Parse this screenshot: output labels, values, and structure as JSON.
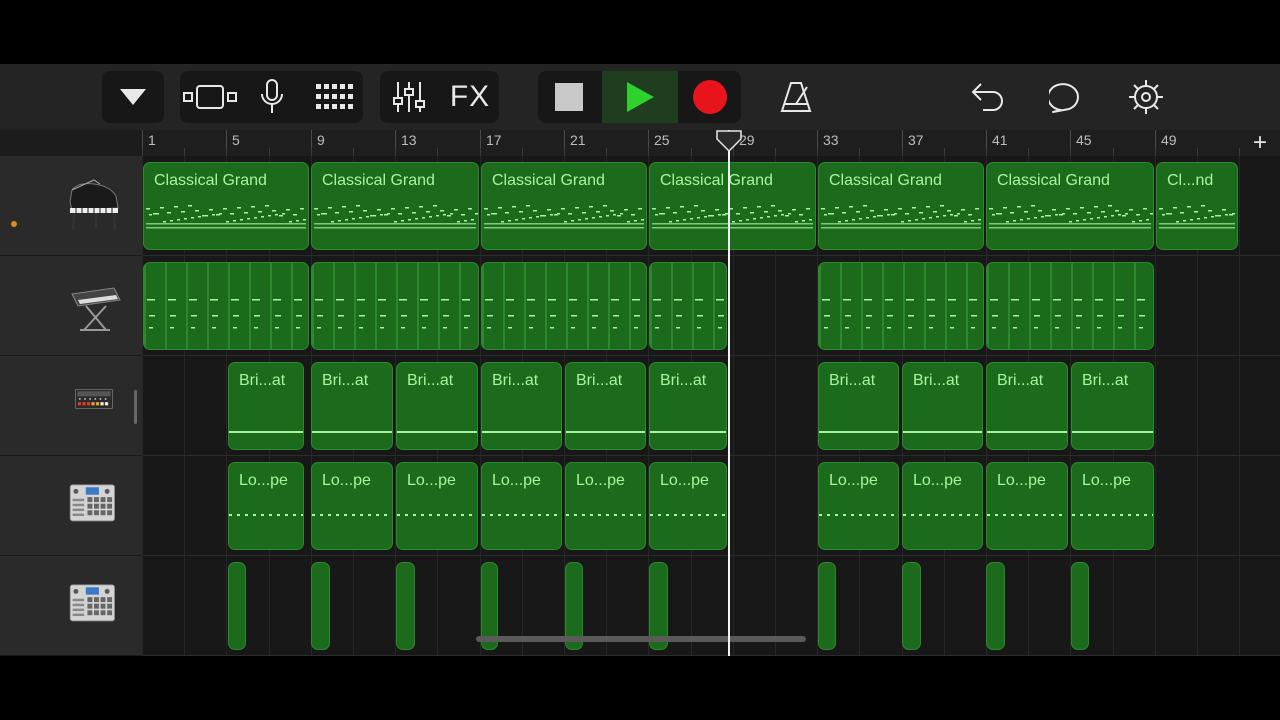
{
  "toolbar": {
    "fx_label": "FX"
  },
  "ruler": {
    "bar_labels": [
      "1",
      "5",
      "9",
      "13",
      "17",
      "21",
      "25",
      "29",
      "33",
      "37",
      "41",
      "45",
      "49"
    ]
  },
  "add_track_label": "+",
  "tracks": [
    {
      "instrument": "grand-piano-icon",
      "selected": true
    },
    {
      "instrument": "keyboard-synth-icon"
    },
    {
      "instrument": "drum-machine-icon"
    },
    {
      "instrument": "beat-sampler-icon"
    },
    {
      "instrument": "beat-sampler-icon"
    }
  ],
  "regions": {
    "track1": [
      "Classical Grand",
      "Classical Grand",
      "Classical Grand",
      "Classical Grand",
      "Classical Grand",
      "Classical Grand",
      "Cl...nd"
    ],
    "track3": [
      "Bri...at",
      "Bri...at",
      "Bri...at",
      "Bri...at",
      "Bri...at",
      "Bri...at",
      "Bri...at",
      "Bri...at",
      "Bri...at",
      "Bri...at"
    ],
    "track4": [
      "Lo...pe",
      "Lo...pe",
      "Lo...pe",
      "Lo...pe",
      "Lo...pe",
      "Lo...pe",
      "Lo...pe",
      "Lo...pe",
      "Lo...pe",
      "Lo...pe"
    ]
  },
  "colors": {
    "region_fill": "#1c6a1c",
    "region_text": "#a9f59b",
    "record": "#e8141c",
    "play": "#2fd12f",
    "selected_dot": "#e08a1c"
  }
}
